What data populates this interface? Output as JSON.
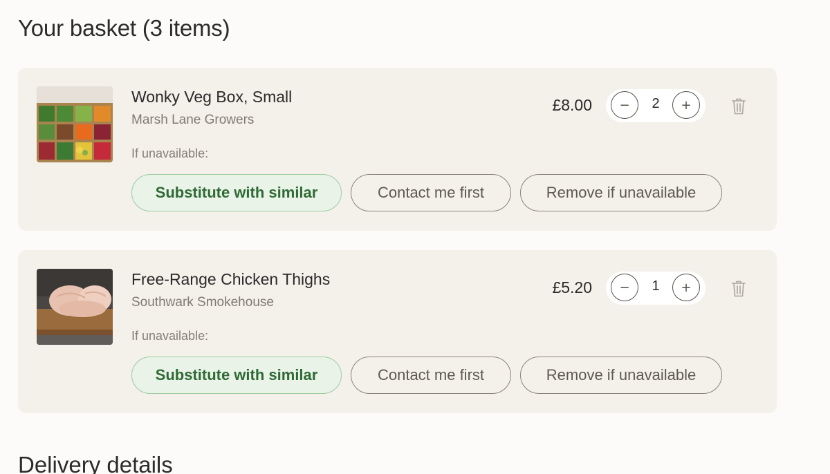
{
  "basket": {
    "title": "Your basket (3 items)",
    "items": [
      {
        "name": "Wonky Veg Box, Small",
        "vendor": "Marsh Lane Growers",
        "price": "£8.00",
        "quantity": "2",
        "image_icon": "veg-box-photo",
        "unavailable_label": "If unavailable:",
        "options": [
          "Substitute with similar",
          "Contact me first",
          "Remove if unavailable"
        ],
        "selected_option": "Substitute with similar"
      },
      {
        "name": "Free-Range Chicken Thighs",
        "vendor": "Southwark Smokehouse",
        "price": "£5.20",
        "quantity": "1",
        "image_icon": "chicken-thighs-photo",
        "unavailable_label": "If unavailable:",
        "options": [
          "Substitute with similar",
          "Contact me first",
          "Remove if unavailable"
        ],
        "selected_option": "Substitute with similar"
      }
    ],
    "stepper": {
      "minus": "−",
      "plus": "+"
    }
  },
  "delivery": {
    "title": "Delivery details"
  },
  "colors": {
    "page_bg": "#fcfbf9",
    "card_bg": "#f4f0ea",
    "selected_bg": "#e9f3e8",
    "selected_border": "#9ccc9f",
    "selected_text": "#2f6a35"
  }
}
